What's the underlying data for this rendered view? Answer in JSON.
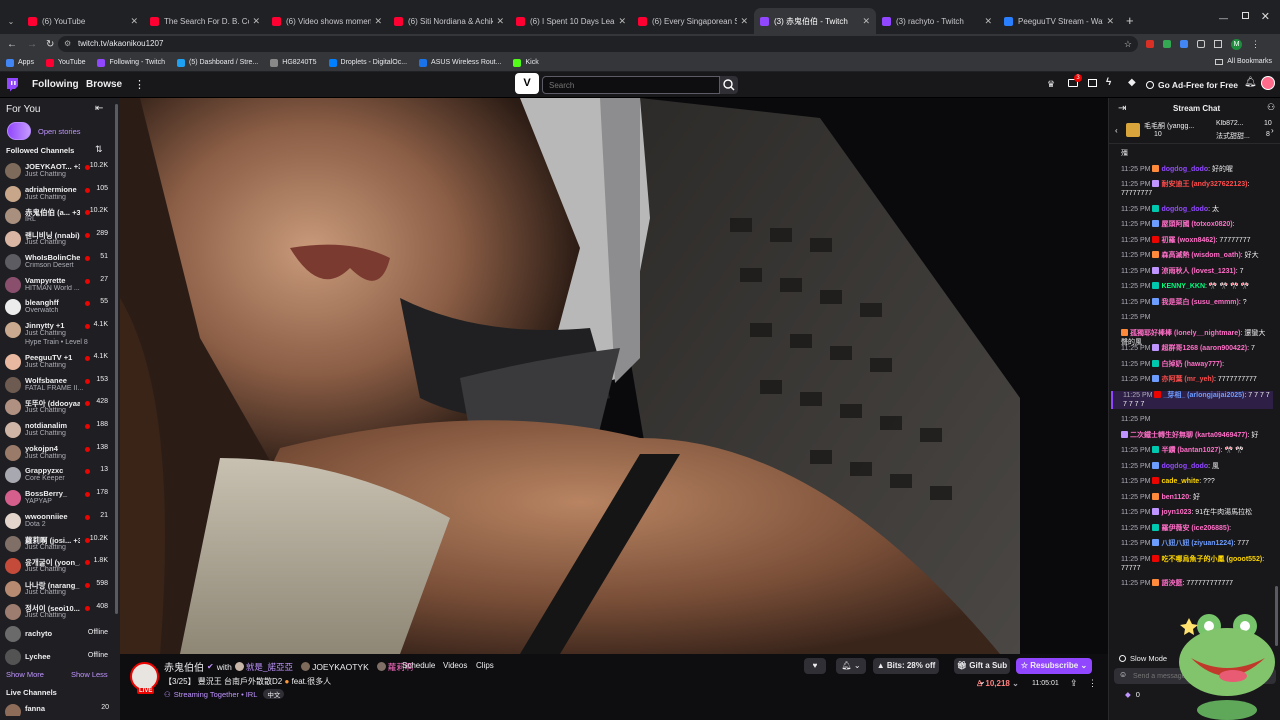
{
  "browser": {
    "tabs": [
      {
        "title": "(6) YouTube",
        "color": "#ff0033"
      },
      {
        "title": "The Search For D. B. Cooper *F",
        "color": "#ff0033"
      },
      {
        "title": "(6) Video shows moment jet slu",
        "color": "#ff0033"
      },
      {
        "title": "(6) Siti Nordiana & Achik - Pali",
        "color": "#ff0033"
      },
      {
        "title": "(6) I Spent 10 Days Learning Ra",
        "color": "#ff0033"
      },
      {
        "title": "(6) Every Singaporean Son IV E",
        "color": "#ff0033"
      },
      {
        "title": "(3) 赤鬼伯伯 - Twitch",
        "color": "#9146ff"
      },
      {
        "title": "(3) rachyto - Twitch",
        "color": "#9146ff"
      },
      {
        "title": "PeeguuTV Stream - Watch Live",
        "color": "#2a7fff"
      }
    ],
    "url": "twitch.tv/akaonikou1207",
    "bookmarks": [
      "Apps",
      "YouTube",
      "Following - Twitch",
      "(5) Dashboard / Stre...",
      "HG8240T5",
      "Droplets - DigitalOc...",
      "ASUS Wireless Rout...",
      "Kick"
    ],
    "all_bookmarks": "All Bookmarks"
  },
  "nav": {
    "following": "Following",
    "browse": "Browse",
    "search_placeholder": "Search",
    "notifications_count": "3",
    "go_ad_free": "Go Ad-Free for Free"
  },
  "sidebar": {
    "for_you": "For You",
    "open_stories": "Open stories",
    "followed_channels": "Followed Channels",
    "channels": [
      {
        "name": "JOEYKAOT... +3",
        "game": "Just Chatting",
        "viewers": "10.2K",
        "live": true,
        "color": "#7d6a5a"
      },
      {
        "name": "adriahermione",
        "game": "Just Chatting",
        "viewers": "105",
        "live": true,
        "color": "#c7a68a"
      },
      {
        "name": "赤鬼伯伯 (a... +3",
        "game": "IRL",
        "viewers": "10.2K",
        "live": true,
        "color": "#a88f7e"
      },
      {
        "name": "랜니비닝 (nnabi)",
        "game": "Just Chatting",
        "viewers": "289",
        "live": true,
        "color": "#d9b6a4"
      },
      {
        "name": "WhoIsBolinChen",
        "game": "Crimson Desert",
        "viewers": "51",
        "live": true,
        "color": "#5c5c62"
      },
      {
        "name": "Vampyrette",
        "game": "HITMAN World ...",
        "viewers": "27",
        "live": true,
        "color": "#8b4f6e"
      },
      {
        "name": "bleanghff",
        "game": "Overwatch",
        "viewers": "55",
        "live": true,
        "color": "#ececec"
      },
      {
        "name": "Jinnytty +1",
        "game": "Just Chatting",
        "extra": "Hype Train • Level 8",
        "viewers": "4.1K",
        "live": true,
        "color": "#c9a98f"
      },
      {
        "name": "PeeguuTV +1",
        "game": "Just Chatting",
        "viewers": "4.1K",
        "live": true,
        "color": "#e8b9a0"
      },
      {
        "name": "Wolfsbanee",
        "game": "FATAL FRAME II...",
        "viewers": "153",
        "live": true,
        "color": "#6d5a50"
      },
      {
        "name": "또뚜아 (ddooyaa)",
        "game": "Just Chatting",
        "viewers": "428",
        "live": true,
        "color": "#b09080"
      },
      {
        "name": "notdianalim",
        "game": "Just Chatting",
        "viewers": "188",
        "live": true,
        "color": "#cfb5a6"
      },
      {
        "name": "yokojpn4",
        "game": "Just Chatting",
        "viewers": "138",
        "live": true,
        "color": "#9a7b6a"
      },
      {
        "name": "Grappyzxc",
        "game": "Core Keeper",
        "viewers": "13",
        "live": true,
        "color": "#a8a8b0"
      },
      {
        "name": "BossBerry_",
        "game": "YAPYAP",
        "viewers": "178",
        "live": true,
        "color": "#d45f8c"
      },
      {
        "name": "wwoonniiee",
        "game": "Dota 2",
        "viewers": "21",
        "live": true,
        "color": "#e3d5cc"
      },
      {
        "name": "蘿莉啊 (josi... +3",
        "game": "Just Chatting",
        "viewers": "10.2K",
        "live": true,
        "color": "#7f6f66"
      },
      {
        "name": "윤개굴이 (yoon_...",
        "game": "Just Chatting",
        "viewers": "1.8K",
        "live": true,
        "color": "#c44a3a"
      },
      {
        "name": "나나랑 (narang_...",
        "game": "Just Chatting",
        "viewers": "598",
        "live": true,
        "color": "#b58a70"
      },
      {
        "name": "정서이 (seoi10...",
        "game": "Just Chatting",
        "viewers": "408",
        "live": true,
        "color": "#9d7d6f"
      },
      {
        "name": "rachyto",
        "game": "",
        "viewers": "Offline",
        "live": false,
        "color": "#8a8a90"
      },
      {
        "name": "Lychee",
        "game": "",
        "viewers": "Offline",
        "live": false,
        "color": "#6a6a70"
      }
    ],
    "show_more": "Show More",
    "show_less": "Show Less",
    "live_channels": "Live Channels",
    "live_partial_name": "fanna",
    "live_partial_viewers": "20"
  },
  "stream": {
    "channel": "赤鬼伯伯",
    "with_label": "with",
    "cohost1": "就是_諾亞亞",
    "cohost2": "JOEYKAOTYK",
    "cohost3": "蘿莉啊",
    "live_badge": "LIVE",
    "title": "【3/25】 豐況王 台南戶外散散D2",
    "title_tail": "feat.很多人",
    "streaming_together": "Streaming Together",
    "category": "IRL",
    "language": "中文",
    "tabs": [
      "Schedule",
      "Videos",
      "Clips"
    ],
    "bits": "Bits: 28% off",
    "gift": "Gift a Sub",
    "resubscribe": "Resubscribe",
    "viewers": "10,218",
    "uptime": "11:05:01"
  },
  "chat": {
    "title": "Stream Chat",
    "top_gifters": [
      {
        "name": "毛毛酮 (yangg...",
        "count": "10"
      },
      {
        "name": "Klb872...",
        "count": "10"
      },
      {
        "name": "法式甜甜...",
        "count": "8"
      }
    ],
    "messages": [
      {
        "time": "",
        "user": "",
        "text": "殭",
        "color": "#efeff1"
      },
      {
        "time": "11:25 PM",
        "user": "dogdog_dodo",
        "text": ": 好的喔",
        "color": "#9147ff"
      },
      {
        "time": "11:25 PM",
        "user": "耐安迪王 (andy327622123)",
        "text": ": 77777777",
        "color": "#ff4d4d"
      },
      {
        "time": "11:25 PM",
        "user": "dogdog_dodo",
        "text": ": 太",
        "color": "#9147ff"
      },
      {
        "time": "11:25 PM",
        "user": "屋頭阿國 (totxox0820)",
        "text": ":",
        "color": "#ff6ec7"
      },
      {
        "time": "11:25 PM",
        "user": "初羅 (woxn8462)",
        "text": ": 77777777",
        "color": "#ff6ec7"
      },
      {
        "time": "11:25 PM",
        "user": "森高滅熱 (wisdom_oath)",
        "text": ": 好大",
        "color": "#ff6ec7"
      },
      {
        "time": "11:25 PM",
        "user": "涼雨秋人 (lovest_1231)",
        "text": ": 7",
        "color": "#ff6ec7"
      },
      {
        "time": "11:25 PM",
        "user": "KENNY_KKN",
        "text": ": 🎌 🎌 🎌 🎌",
        "color": "#00ff7f"
      },
      {
        "time": "11:25 PM",
        "user": "我是菜白 (susu_emmm)",
        "text": ": ?",
        "color": "#ff6ec7"
      },
      {
        "time": "11:25 PM",
        "user": "",
        "text": "",
        "color": "#efeff1"
      },
      {
        "time": "",
        "user": "孤獨耶好棒棒 (lonely__nightmare)",
        "text": ": 還蠻大聲的風",
        "color": "#ff6ec7"
      },
      {
        "time": "11:25 PM",
        "user": "超群哥1268 (aaron900422)",
        "text": ": 7",
        "color": "#ff6ec7"
      },
      {
        "time": "11:25 PM",
        "user": "白掉奶 (haway777)",
        "text": ":",
        "color": "#ff6ec7"
      },
      {
        "time": "11:25 PM",
        "user": "亦阿葉 (mr_yeh)",
        "text": ": 7777777777",
        "color": "#ff4d4d"
      },
      {
        "time": "11:25 PM",
        "user": "_芽相_ (arlongjaijai2025)",
        "text": ": 7 7 7 7 7 7 7 7",
        "color": "#6d9cff",
        "highlight": true
      },
      {
        "time": "11:25 PM",
        "user": "",
        "text": "",
        "color": "#efeff1"
      },
      {
        "time": "",
        "user": "二次鐵士轉生好無聊 (karta09469477)",
        "text": ": 好",
        "color": "#ff6ec7"
      },
      {
        "time": "11:25 PM",
        "user": "半鑽 (bantan1027)",
        "text": ": 🎌 🎌",
        "color": "#ff6ec7"
      },
      {
        "time": "11:25 PM",
        "user": "dogdog_dodo",
        "text": ": 風",
        "color": "#9147ff"
      },
      {
        "time": "11:25 PM",
        "user": "cade_white",
        "text": ": ???",
        "color": "#ffd700"
      },
      {
        "time": "11:25 PM",
        "user": "ben1120",
        "text": ": 好",
        "color": "#ff6ec7"
      },
      {
        "time": "11:25 PM",
        "user": "joyn1023",
        "text": ": 91在牛肉湯馬拉松",
        "color": "#ff6ec7"
      },
      {
        "time": "11:25 PM",
        "user": "羅伊薇安 (ice206885)",
        "text": ":",
        "color": "#ff6ec7"
      },
      {
        "time": "11:25 PM",
        "user": "八妞八妞 (ziyuan1224)",
        "text": ": 777",
        "color": "#6d9cff"
      },
      {
        "time": "11:25 PM",
        "user": "吃不哪烏魚子的小鳳 (gooot552)",
        "text": ": 77777",
        "color": "#ffd700"
      },
      {
        "time": "11:25 PM",
        "user": "語泱筵",
        "text": ": 777777777777",
        "color": "#ff6ec7"
      }
    ],
    "slow_mode": "Slow Mode",
    "send_placeholder": "Send a message",
    "points": "0"
  }
}
